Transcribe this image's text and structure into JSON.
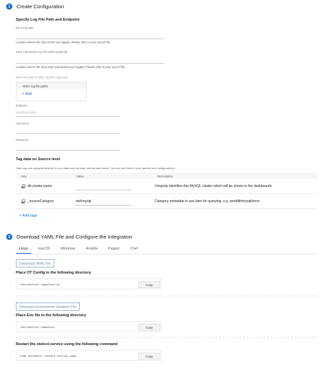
{
  "step1": {
    "number": "1",
    "title": "Create Configuration",
    "section_title": "Specify Log File Path and Endpoint",
    "error_log_label": "Error log path",
    "error_log_hint": "Location where the SQL Errors are logged. Please refer to your my.cnf file",
    "slow_log_label": "Slow Transaction log file paths (optional)",
    "slow_log_hint": "Location where the Slow SQL transactions are logged. Please refer to your my.cnf file",
    "other_paths_hint": "Enter the path of other log files (optional)",
    "other_paths_header": "Other log file paths",
    "add_label": "+ Add",
    "endpoint_label": "Endpoint",
    "endpoint_placeholder": "localhost:3306",
    "username_label": "Username",
    "password_label": "Password"
  },
  "tags": {
    "title": "Tag data on Source level",
    "description": "Data tags are assigned directly to your data such as logs, metrics and traces. You can use them in your queries and configurations.",
    "columns": {
      "key": "Key",
      "value": "Value",
      "description": "Description"
    },
    "rows": [
      {
        "key": "db.cluster.name",
        "value": "",
        "description": "Uniquely identifies this MySQL cluster which will be shown in the dashboards"
      },
      {
        "key": "_sourceCategory",
        "value": "otel/mysql",
        "description": "Category metadata to use later for querying, e.g. prod/db/mysql/error"
      }
    ],
    "add_label": "+ Add tags"
  },
  "step2": {
    "number": "2",
    "title": "Download YAML File and Configure the Integration",
    "tabs": [
      "Linux",
      "macOS",
      "Windows",
      "Ansible",
      "Puppet",
      "Chef"
    ],
    "active_tab": "Linux",
    "download_yaml": "Download YAML File",
    "otconfig_title": "Place OT Config in the following directory",
    "otconfig_path": "/etc/otelcol-sumo/conf.d/",
    "download_env": "Download Environment Variables File",
    "env_title": "Place Env file in the following directory",
    "env_path": "/etc/otelcol-sumo/env/",
    "restart_title": "Restart the otelcol-service using the following command",
    "restart_cmd": "sudo systemctl restart otelcol-sumo",
    "copy_label": "Copy"
  },
  "colors": {
    "accent": "#1f6ad6",
    "text": "#1a1a1a",
    "muted": "#7a7a7a"
  }
}
